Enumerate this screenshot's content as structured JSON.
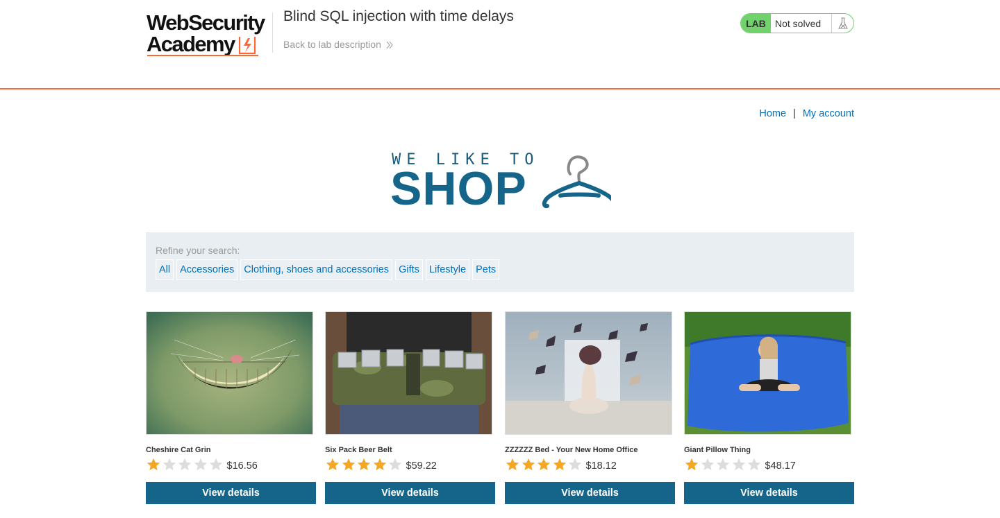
{
  "header": {
    "logo_line1": "WebSecurity",
    "logo_line2": "Academy",
    "lab_title": "Blind SQL injection with time delays",
    "back_link": "Back to lab description",
    "lab_badge": "LAB",
    "lab_state": "Not solved"
  },
  "nav": {
    "home": "Home",
    "separator": "|",
    "my_account": "My account"
  },
  "banner": {
    "tagline": "WE LIKE TO",
    "word": "SHOP"
  },
  "filters": {
    "label": "Refine your search:",
    "categories": [
      "All",
      "Accessories",
      "Clothing, shoes and accessories",
      "Gifts",
      "Lifestyle",
      "Pets"
    ]
  },
  "products": [
    {
      "name": "Cheshire Cat Grin",
      "rating": 1,
      "price": "$16.56",
      "button": "View details"
    },
    {
      "name": "Six Pack Beer Belt",
      "rating": 4,
      "price": "$59.22",
      "button": "View details"
    },
    {
      "name": "ZZZZZZ Bed - Your New Home Office",
      "rating": 4,
      "price": "$18.12",
      "button": "View details"
    },
    {
      "name": "Giant Pillow Thing",
      "rating": 1,
      "price": "$48.17",
      "button": "View details"
    }
  ],
  "colors": {
    "accent_orange": "#ff6633",
    "link_blue": "#0071bc",
    "button_blue": "#15648a",
    "status_green": "#70d16d",
    "star_gold": "#f5a623",
    "star_grey": "#dddddd"
  }
}
